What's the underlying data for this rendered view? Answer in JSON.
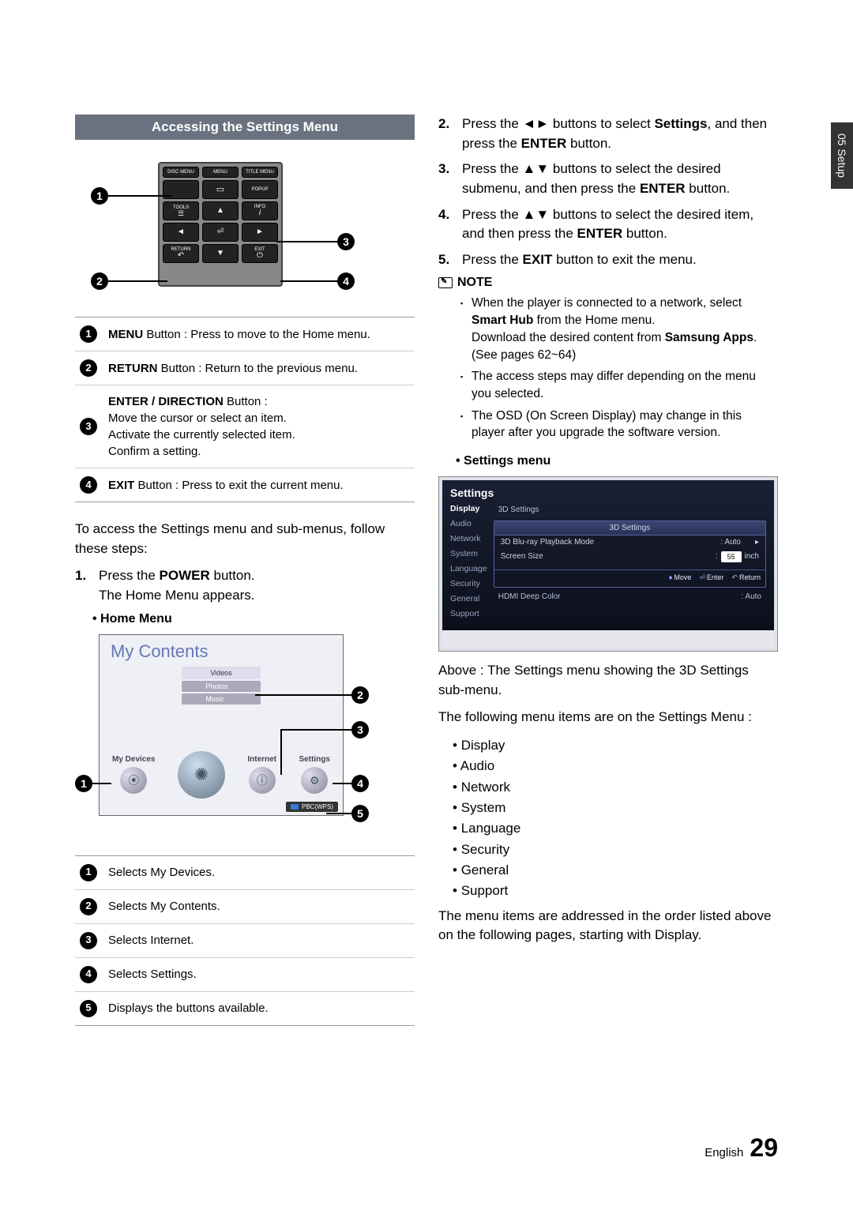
{
  "pageTab": "05   Setup",
  "sectionTitle": "Accessing the Settings Menu",
  "remote": {
    "topLabels": [
      "DISC MENU",
      "MENU",
      "TITLE MENU"
    ],
    "topRow2": [
      "",
      "▭",
      "POPUP"
    ],
    "row2": {
      "left": "TOOLS",
      "leftIcon": "☰",
      "center": "▲",
      "right": "INFO",
      "rightIcon": "i"
    },
    "row3": {
      "left": "◄",
      "center": "⏎",
      "right": "►"
    },
    "row4": {
      "left": "RETURN",
      "leftIcon": "↶",
      "center": "▼",
      "right": "EXIT",
      "rightIcon": "⏻"
    },
    "callouts": {
      "c1": "1",
      "c2": "2",
      "c3": "3",
      "c4": "4"
    }
  },
  "buttonTable": [
    {
      "num": "1",
      "html": "<b>MENU</b> Button : Press to move to the Home menu."
    },
    {
      "num": "2",
      "html": "<b>RETURN</b> Button : Return to the previous menu."
    },
    {
      "num": "3",
      "html": "<b>ENTER / DIRECTION</b> Button :<br>Move the cursor or select an item.<br>Activate the currently selected item.<br>Confirm a setting."
    },
    {
      "num": "4",
      "html": "<b>EXIT</b> Button : Press to exit the current menu."
    }
  ],
  "intro": "To access the Settings menu and sub-menus, follow these steps:",
  "step1": {
    "num": "1.",
    "text": "Press the <b>POWER</b> button.<br>The Home Menu appears."
  },
  "homeMenuHeading": "Home Menu",
  "homeFig": {
    "title": "My Contents",
    "cats": [
      "Videos",
      "Photos",
      "Music"
    ],
    "items": [
      {
        "label": "My Devices",
        "icon": "⦿"
      },
      {
        "label": "",
        "icon": "✺",
        "big": true
      },
      {
        "label": "Internet",
        "icon": "ⓘ"
      },
      {
        "label": "Settings",
        "icon": "⚙"
      }
    ],
    "bottom": "PBC(WPS)",
    "callouts": {
      "c1": "1",
      "c2": "2",
      "c3": "3",
      "c4": "4",
      "c5": "5"
    }
  },
  "homeTable": [
    {
      "num": "1",
      "text": "Selects My Devices."
    },
    {
      "num": "2",
      "text": "Selects My Contents."
    },
    {
      "num": "3",
      "text": "Selects Internet."
    },
    {
      "num": "4",
      "text": "Selects Settings."
    },
    {
      "num": "5",
      "text": "Displays the buttons available."
    }
  ],
  "steps": [
    {
      "num": "2.",
      "text": "Press the ◄► buttons to select <b>Settings</b>, and then press the <b>ENTER</b> button."
    },
    {
      "num": "3.",
      "text": "Press the ▲▼ buttons to select the desired submenu, and then press the <b>ENTER</b> button."
    },
    {
      "num": "4.",
      "text": "Press the ▲▼ buttons to select the desired item, and then press the <b>ENTER</b> button."
    },
    {
      "num": "5.",
      "text": "Press the <b>EXIT</b> button to exit the menu."
    }
  ],
  "noteLabel": "NOTE",
  "notes": [
    "When the player is connected to a network, select <b>Smart Hub</b> from the Home menu.<br>Download the desired content from <b>Samsung Apps</b>. (See pages 62~64)",
    "The access steps may differ depending on the menu you selected.",
    "The OSD (On Screen Display) may change in this player after you upgrade the software version."
  ],
  "settingsMenuHeading": "Settings menu",
  "osd": {
    "title": "Settings",
    "side": [
      "Display",
      "Audio",
      "Network",
      "System",
      "Language",
      "Security",
      "General",
      "Support"
    ],
    "topRow": "3D Settings",
    "panelHead": "3D Settings",
    "rows": [
      {
        "label": "3D Blu-ray Playback Mode",
        "value": ": Auto",
        "arrow": "▸"
      },
      {
        "label": "Screen Size",
        "value": "55",
        "suffix": "inch",
        "input": true,
        "prefix": ": "
      }
    ],
    "hints": [
      {
        "icon": "♦",
        "text": "Move"
      },
      {
        "icon": "⏎",
        "text": "Enter"
      },
      {
        "icon": "↶",
        "text": "Return"
      }
    ],
    "bottomRow": {
      "label": "HDMI Deep Color",
      "value": ": Auto"
    }
  },
  "caption": "Above : The Settings menu showing the 3D Settings sub-menu.",
  "following": "The following menu items are on the Settings Menu :",
  "menuItems": [
    "Display",
    "Audio",
    "Network",
    "System",
    "Language",
    "Security",
    "General",
    "Support"
  ],
  "closing": "The menu items are addressed in the order listed above on the following pages, starting with Display.",
  "footer": {
    "lang": "English",
    "page": "29"
  }
}
